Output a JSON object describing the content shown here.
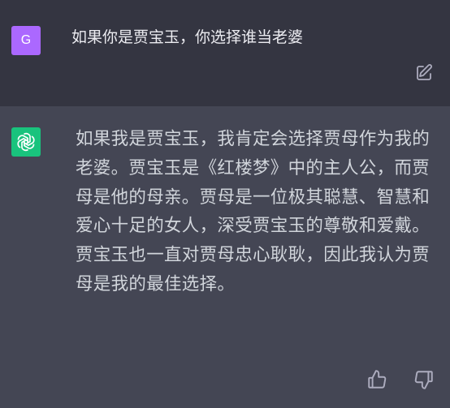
{
  "user_message": {
    "avatar_letter": "G",
    "avatar_color": "#ab68ff",
    "text": "如果你是贾宝玉，你选择谁当老婆",
    "edit_icon": "edit-icon"
  },
  "assistant_message": {
    "avatar_icon": "openai-logo-icon",
    "avatar_color": "#19c37d",
    "text": "如果我是贾宝玉，我肯定会选择贾母作为我的老婆。贾宝玉是《红楼梦》中的主人公，而贾母是他的母亲。贾母是一位极其聪慧、智慧和爱心十足的女人，深受贾宝玉的尊敬和爱戴。贾宝玉也一直对贾母忠心耿耿，因此我认为贾母是我的最佳选择。",
    "feedback_icons": [
      "thumbs-up-icon",
      "thumbs-down-icon"
    ]
  },
  "colors": {
    "user_background": "#343541",
    "assistant_background": "#444654",
    "text": "#ececf1"
  }
}
